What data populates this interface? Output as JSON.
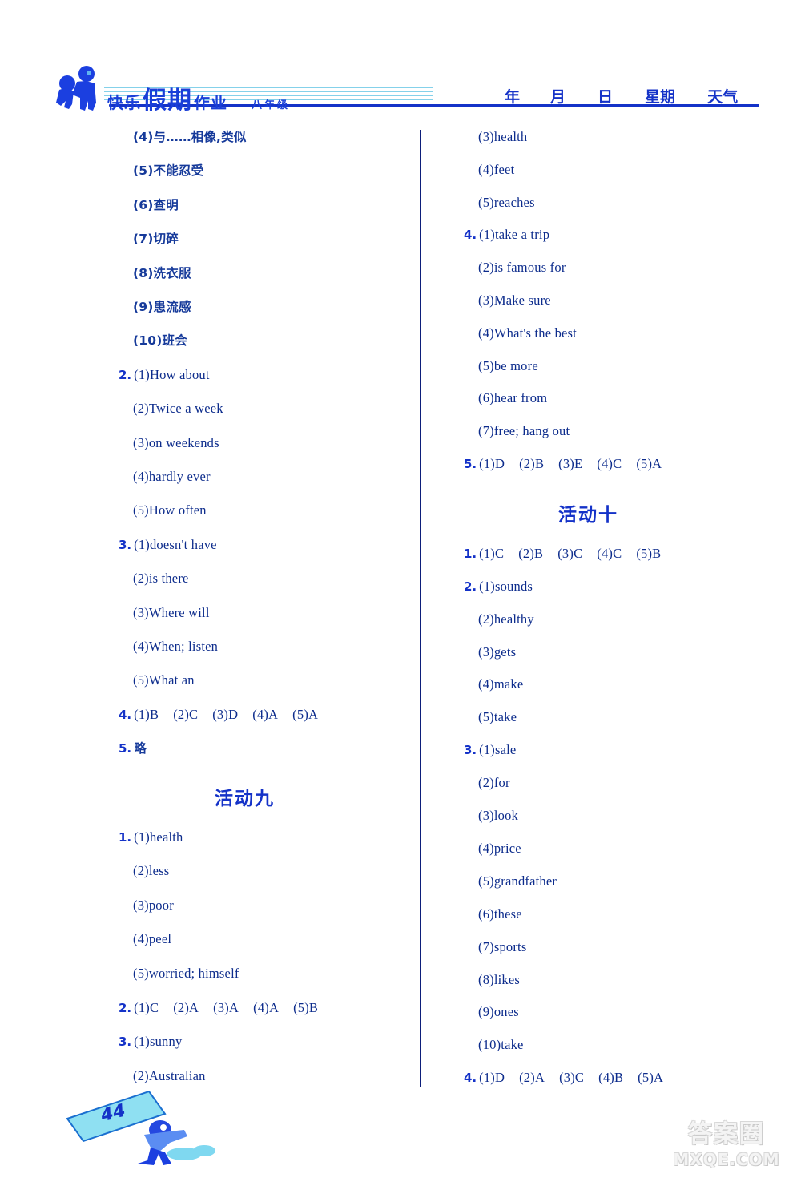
{
  "header": {
    "title_part1": "快乐",
    "title_part2": "假期",
    "title_part3": "作业",
    "grade": "八年级",
    "date_fields": {
      "year": "年",
      "month": "月",
      "day": "日",
      "weekday": "星期",
      "weather": "天气"
    }
  },
  "left_column": {
    "lines": [
      {
        "num": "",
        "text": "(4)与……相像,类似",
        "cn": true
      },
      {
        "num": "",
        "text": "(5)不能忍受",
        "cn": true
      },
      {
        "num": "",
        "text": "(6)查明",
        "cn": true
      },
      {
        "num": "",
        "text": "(7)切碎",
        "cn": true
      },
      {
        "num": "",
        "text": "(8)洗衣服",
        "cn": true
      },
      {
        "num": "",
        "text": "(9)患流感",
        "cn": true
      },
      {
        "num": "",
        "text": "(10)班会",
        "cn": true
      },
      {
        "num": "2.",
        "text": "(1)How about"
      },
      {
        "num": "",
        "text": "(2)Twice a week"
      },
      {
        "num": "",
        "text": "(3)on weekends"
      },
      {
        "num": "",
        "text": "(4)hardly ever"
      },
      {
        "num": "",
        "text": "(5)How often"
      },
      {
        "num": "3.",
        "text": "(1)doesn't have"
      },
      {
        "num": "",
        "text": "(2)is there"
      },
      {
        "num": "",
        "text": "(3)Where will"
      },
      {
        "num": "",
        "text": "(4)When; listen"
      },
      {
        "num": "",
        "text": "(5)What an"
      },
      {
        "num": "4.",
        "choices": [
          "(1)B",
          "(2)C",
          "(3)D",
          "(4)A",
          "(5)A"
        ]
      },
      {
        "num": "5.",
        "text": "略",
        "cn": true
      }
    ],
    "section_title": "活动九",
    "section_lines": [
      {
        "num": "1.",
        "text": "(1)health"
      },
      {
        "num": "",
        "text": "(2)less"
      },
      {
        "num": "",
        "text": "(3)poor"
      },
      {
        "num": "",
        "text": "(4)peel"
      },
      {
        "num": "",
        "text": "(5)worried; himself"
      },
      {
        "num": "2.",
        "choices": [
          "(1)C",
          "(2)A",
          "(3)A",
          "(4)A",
          "(5)B"
        ]
      },
      {
        "num": "3.",
        "text": "(1)sunny"
      },
      {
        "num": "",
        "text": "(2)Australian"
      }
    ]
  },
  "right_column": {
    "lines": [
      {
        "num": "",
        "text": "(3)health"
      },
      {
        "num": "",
        "text": "(4)feet"
      },
      {
        "num": "",
        "text": "(5)reaches"
      },
      {
        "num": "4.",
        "text": "(1)take a trip"
      },
      {
        "num": "",
        "text": "(2)is famous for"
      },
      {
        "num": "",
        "text": "(3)Make sure"
      },
      {
        "num": "",
        "text": "(4)What's the best"
      },
      {
        "num": "",
        "text": "(5)be more"
      },
      {
        "num": "",
        "text": "(6)hear from"
      },
      {
        "num": "",
        "text": "(7)free; hang out"
      },
      {
        "num": "5.",
        "choices": [
          "(1)D",
          "(2)B",
          "(3)E",
          "(4)C",
          "(5)A"
        ]
      }
    ],
    "section_title": "活动十",
    "section_lines": [
      {
        "num": "1.",
        "choices": [
          "(1)C",
          "(2)B",
          "(3)C",
          "(4)C",
          "(5)B"
        ]
      },
      {
        "num": "2.",
        "text": "(1)sounds"
      },
      {
        "num": "",
        "text": "(2)healthy"
      },
      {
        "num": "",
        "text": "(3)gets"
      },
      {
        "num": "",
        "text": "(4)make"
      },
      {
        "num": "",
        "text": "(5)take"
      },
      {
        "num": "3.",
        "text": "(1)sale"
      },
      {
        "num": "",
        "text": "(2)for"
      },
      {
        "num": "",
        "text": "(3)look"
      },
      {
        "num": "",
        "text": "(4)price"
      },
      {
        "num": "",
        "text": "(5)grandfather"
      },
      {
        "num": "",
        "text": "(6)these"
      },
      {
        "num": "",
        "text": "(7)sports"
      },
      {
        "num": "",
        "text": "(8)likes"
      },
      {
        "num": "",
        "text": "(9)ones"
      },
      {
        "num": "",
        "text": "(10)take"
      },
      {
        "num": "4.",
        "choices": [
          "(1)D",
          "(2)A",
          "(3)C",
          "(4)B",
          "(5)A"
        ]
      }
    ]
  },
  "footer": {
    "page_number": "44",
    "watermark_cn": "答案圈",
    "watermark_en": "MXQE.COM"
  },
  "colors": {
    "title_blue": "#1a3fd8",
    "rule_blue": "#1432c8",
    "text_navy": "#0d2c8c",
    "stripe_cyan": "#6fc9e6"
  }
}
